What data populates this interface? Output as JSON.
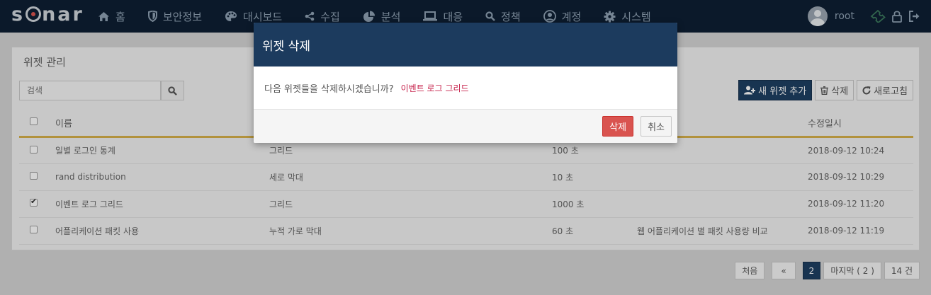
{
  "app": {
    "logo": "sonar"
  },
  "nav": {
    "items": [
      {
        "label": "홈",
        "icon": "home-icon"
      },
      {
        "label": "보안정보",
        "icon": "shield-icon"
      },
      {
        "label": "대시보드",
        "icon": "palette-icon"
      },
      {
        "label": "수집",
        "icon": "share-icon"
      },
      {
        "label": "분석",
        "icon": "pie-chart-icon"
      },
      {
        "label": "대응",
        "icon": "laptop-icon"
      },
      {
        "label": "정책",
        "icon": "search-icon"
      },
      {
        "label": "계정",
        "icon": "user-circle-icon"
      },
      {
        "label": "시스템",
        "icon": "gear-icon"
      }
    ],
    "username": "root"
  },
  "page": {
    "title": "위젯 관리",
    "search_placeholder": "검색",
    "toolbar": {
      "add_label": "새 위젯 추가",
      "delete_label": "삭제",
      "refresh_label": "새로고침"
    },
    "table": {
      "headers": [
        "이름",
        "",
        "",
        "",
        "수정일시"
      ],
      "rows": [
        {
          "checked": false,
          "name": "일별 로그인 통계",
          "type": "그리드",
          "interval": "100 초",
          "desc": "",
          "modified": "2018-09-12 10:24"
        },
        {
          "checked": false,
          "name": "rand distribution",
          "type": "세로 막대",
          "interval": "10 초",
          "desc": "",
          "modified": "2018-09-12 10:29"
        },
        {
          "checked": true,
          "name": "이벤트 로그 그리드",
          "type": "그리드",
          "interval": "1000 초",
          "desc": "",
          "modified": "2018-09-12 11:20"
        },
        {
          "checked": false,
          "name": "어플리케이션 패킷 사용",
          "type": "누적 가로 막대",
          "interval": "60 초",
          "desc": "웹 어플리케이션 별 패킷 사용량 비교",
          "modified": "2018-09-12 11:19"
        }
      ]
    },
    "pager": {
      "first": "처음",
      "prev": "«",
      "current": "2",
      "last": "마지막 ( 2 )",
      "total": "14 건"
    }
  },
  "modal": {
    "title": "위젯 삭제",
    "message": "다음 위젯들을 삭제하시겠습니까?",
    "target": "이벤트 로그 그리드",
    "confirm_label": "삭제",
    "cancel_label": "취소"
  },
  "colors": {
    "navbar": "#0e1f33",
    "modal_header": "#1c3b5e",
    "danger": "#d9534f",
    "primary": "#1e3f62",
    "accent_line": "#d6b04a",
    "target_text": "#c7254e"
  }
}
